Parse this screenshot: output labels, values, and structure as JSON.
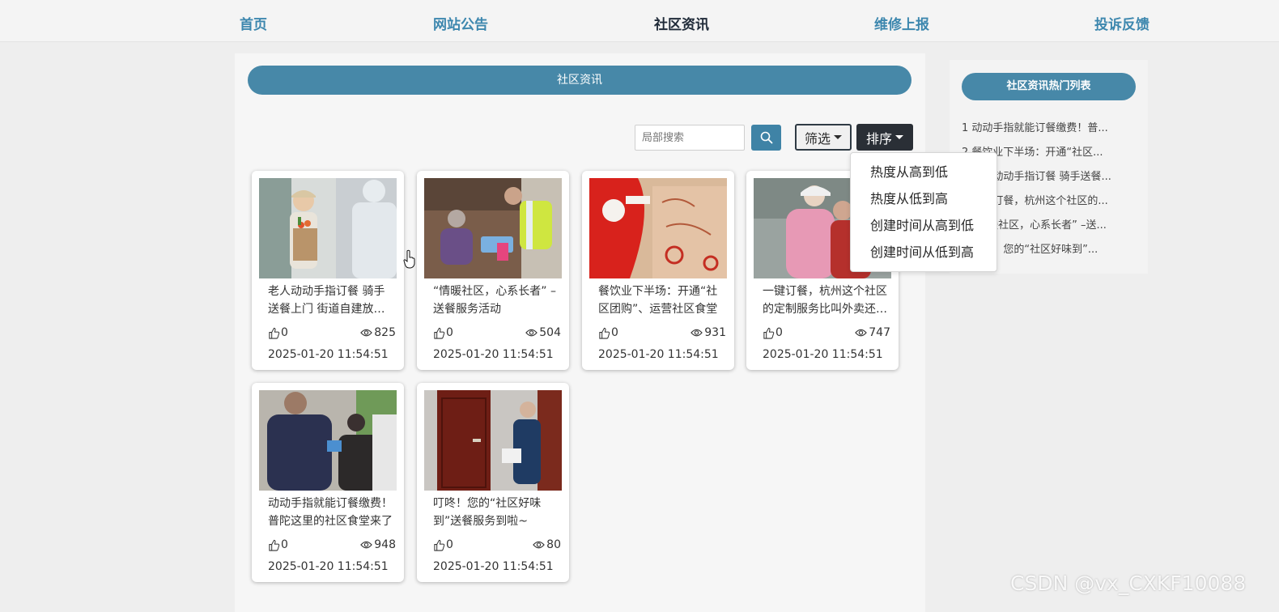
{
  "nav": {
    "items": [
      "首页",
      "网站公告",
      "社区资讯",
      "维修上报",
      "投诉反馈"
    ],
    "active_index": 2
  },
  "section_title": "社区资讯",
  "toolbar": {
    "search_placeholder": "局部搜索",
    "filter_label": "筛选",
    "sort_label": "排序"
  },
  "sort_menu": {
    "items": [
      "热度从高到低",
      "热度从低到高",
      "创建时间从高到低",
      "创建时间从低到高"
    ]
  },
  "cards": [
    {
      "title": "老人动动手指订餐 骑手送餐上门 街道自建放心食堂",
      "likes": "0",
      "views": "825",
      "date": "2025-01-20 11:54:51",
      "image_icon": "delivery-photo-icon"
    },
    {
      "title": "“情暖社区，心系长者” –送餐服务活动",
      "likes": "0",
      "views": "504",
      "date": "2025-01-20 11:54:51",
      "image_icon": "volunteer-photo-icon"
    },
    {
      "title": "餐饮业下半场：开通“社区团购”、运营社区食堂",
      "likes": "0",
      "views": "931",
      "date": "2025-01-20 11:54:51",
      "image_icon": "takeout-photo-icon"
    },
    {
      "title": "一键订餐，杭州这个社区的定制服务比叫外卖还方便",
      "likes": "0",
      "views": "747",
      "date": "2025-01-20 11:54:51",
      "image_icon": "elderly-photo-icon"
    },
    {
      "title": "动动手指就能订餐缴费！普陀这里的社区食堂来了",
      "likes": "0",
      "views": "948",
      "date": "2025-01-20 11:54:51",
      "image_icon": "tablet-photo-icon"
    },
    {
      "title": "叮咚！您的“社区好味到”送餐服务到啦~",
      "likes": "0",
      "views": "80",
      "date": "2025-01-20 11:54:51",
      "image_icon": "doorstep-photo-icon"
    }
  ],
  "hot_list": {
    "title": "社区资讯热门列表",
    "items": [
      "1  动动手指就能订餐缴费！普...",
      "2  餐饮业下半场：开通“社区...",
      "3  老人动动手指订餐 骑手送餐...",
      "4  一键订餐，杭州这个社区的...",
      "5  “情暖社区，心系长者” –送...",
      "6  叮咚！您的“社区好味到”..."
    ]
  },
  "watermark": "CSDN @vx_CXKF10088",
  "colors": {
    "accent": "#4788a8",
    "nav_link": "#3d87ae",
    "nav_active": "#1f2a38",
    "sort_button": "#2a2f36"
  }
}
